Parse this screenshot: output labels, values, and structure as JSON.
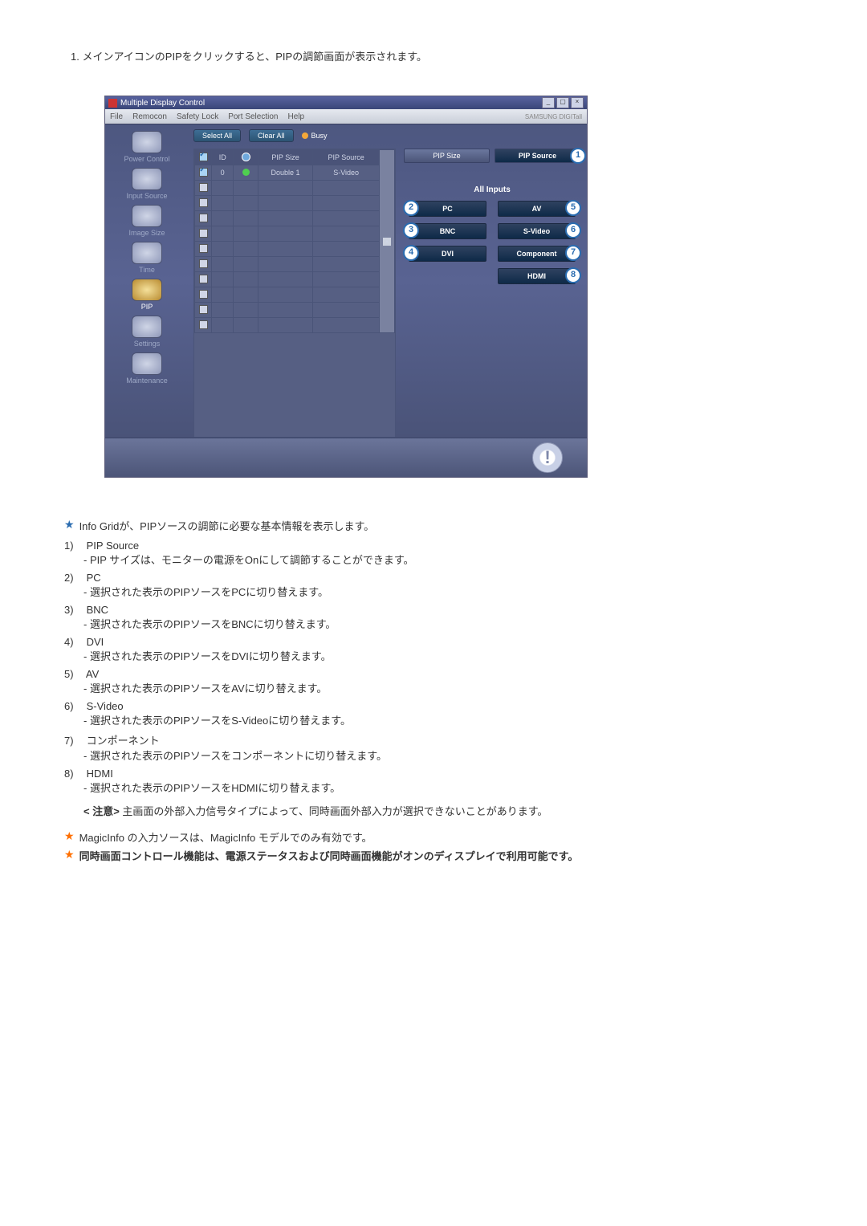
{
  "intro": "1.  メインアイコンのPIPをクリックすると、PIPの調節画面が表示されます。",
  "window": {
    "title": "Multiple Display Control",
    "menus": [
      "File",
      "Remocon",
      "Safety Lock",
      "Port Selection",
      "Help"
    ],
    "brand": "SAMSUNG DIGITall"
  },
  "sidebar": [
    {
      "label": "Power Control"
    },
    {
      "label": "Input Source"
    },
    {
      "label": "Image Size"
    },
    {
      "label": "Time"
    },
    {
      "label": "PIP",
      "active": true
    },
    {
      "label": "Settings"
    },
    {
      "label": "Maintenance"
    }
  ],
  "toolbar": {
    "select_all": "Select All",
    "clear_all": "Clear All",
    "busy": "Busy"
  },
  "grid": {
    "headers": {
      "chk": "",
      "id": "ID",
      "pwr": "",
      "size": "PIP Size",
      "src": "PIP Source"
    },
    "row": {
      "id": "0",
      "size": "Double 1",
      "src": "S-Video"
    }
  },
  "right": {
    "tabs": {
      "size": "PIP Size",
      "source": "PIP Source"
    },
    "all_inputs": "All Inputs",
    "buttons": {
      "pc": "PC",
      "av": "AV",
      "bnc": "BNC",
      "svideo": "S-Video",
      "dvi": "DVI",
      "component": "Component",
      "hdmi": "HDMI"
    },
    "badges": {
      "source": "1",
      "pc": "2",
      "bnc": "3",
      "dvi": "4",
      "av": "5",
      "svideo": "6",
      "component": "7",
      "hdmi": "8"
    }
  },
  "doc": {
    "info_grid": "Info Gridが、PIPソースの調節に必要な基本情報を表示します。",
    "items": [
      {
        "n": "1)",
        "t": "PIP Source",
        "d": "- PIP サイズは、モニターの電源をOnにして調節することができます。"
      },
      {
        "n": "2)",
        "t": "PC",
        "d": "- 選択された表示のPIPソースをPCに切り替えます。"
      },
      {
        "n": "3)",
        "t": "BNC",
        "d": "- 選択された表示のPIPソースをBNCに切り替えます。"
      },
      {
        "n": "4)",
        "t": "DVI",
        "d": "- 選択された表示のPIPソースをDVIに切り替えます。"
      },
      {
        "n": "5)",
        "t": "AV",
        "d": "- 選択された表示のPIPソースをAVに切り替えます。"
      },
      {
        "n": "6)",
        "t": "S-Video",
        "d": "- 選択された表示のPIPソースをS-Videoに切り替えます。"
      },
      {
        "n": "7)",
        "t": "コンポーネント",
        "d": "- 選択された表示のPIPソースをコンポーネントに切り替えます。"
      },
      {
        "n": "8)",
        "t": "HDMI",
        "d": "- 選択された表示のPIPソースをHDMIに切り替えます。"
      }
    ],
    "caution_label": "< 注意>",
    "caution_text": "主画面の外部入力信号タイプによって、同時画面外部入力が選択できないことがあります。",
    "magicinfo": "MagicInfo の入力ソースは、MagicInfo モデルでのみ有効です。",
    "final": "同時画面コントロール機能は、電源ステータスおよび同時画面機能がオンのディスプレイで利用可能です。"
  }
}
